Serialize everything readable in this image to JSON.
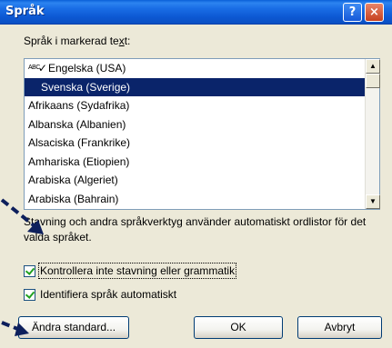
{
  "window": {
    "title": "Språk"
  },
  "titlebar": {
    "help_label": "?",
    "close_label": "×"
  },
  "language_list": {
    "label": "Språk i markerad text:",
    "items": [
      {
        "label": "Engelska (USA)",
        "prefix": "ABC",
        "selected": false
      },
      {
        "label": "Svenska (Sverige)",
        "selected": true
      },
      {
        "label": "Afrikaans (Sydafrika)",
        "selected": false
      },
      {
        "label": "Albanska (Albanien)",
        "selected": false
      },
      {
        "label": "Alsaciska (Frankrike)",
        "selected": false
      },
      {
        "label": "Amhariska (Etiopien)",
        "selected": false
      },
      {
        "label": "Arabiska (Algeriet)",
        "selected": false
      },
      {
        "label": "Arabiska (Bahrain)",
        "selected": false
      }
    ]
  },
  "info": {
    "text": "Stavning och andra språkverktyg använder automatiskt ordlistor för det valda språket."
  },
  "options": {
    "no_proofing": {
      "label": "Kontrollera inte stavning eller grammatik",
      "checked": true
    },
    "detect_language": {
      "label": "Identifiera språk automatiskt",
      "checked": true
    }
  },
  "buttons": {
    "set_default": "Ändra standard...",
    "ok": "OK",
    "cancel": "Avbryt"
  },
  "colors": {
    "titlebar": "#0a5fd8",
    "selection": "#0a246a",
    "annotation_arrow": "#0d1f5c"
  }
}
